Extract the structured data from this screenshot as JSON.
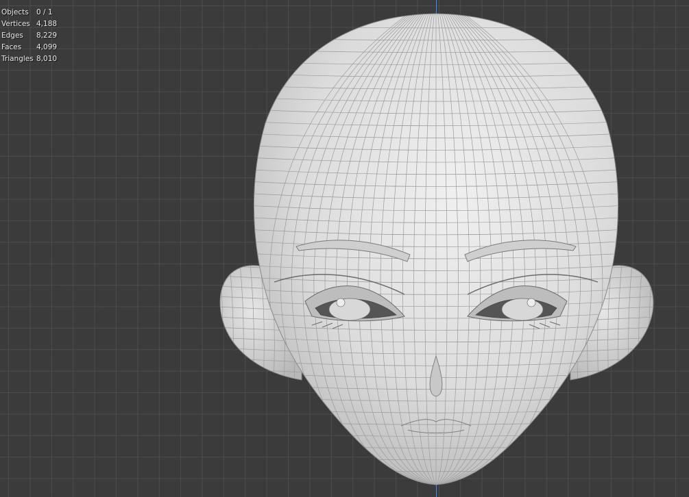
{
  "stats": {
    "objects": {
      "label": "Objects",
      "value": "0 / 1"
    },
    "vertices": {
      "label": "Vertices",
      "value": "4,188"
    },
    "edges": {
      "label": "Edges",
      "value": "8,229"
    },
    "faces": {
      "label": "Faces",
      "value": "4,099"
    },
    "triangles": {
      "label": "Triangles",
      "value": "8,010"
    }
  },
  "colors": {
    "background": "#3b3b3b",
    "grid": "#5a5a5a",
    "axis_z": "#5f86c4",
    "mesh_fill": "#d9d9d9",
    "wire": "#8c8c8c"
  },
  "icons": {
    "model": "head-mesh-icon"
  }
}
